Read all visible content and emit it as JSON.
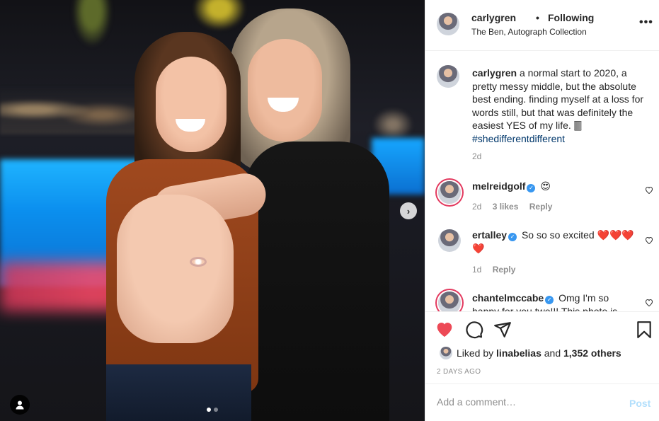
{
  "header": {
    "username": "carlygren",
    "separator": "•",
    "follow_state": "Following",
    "location": "The Ben, Autograph Collection",
    "more_label": "•••"
  },
  "caption": {
    "username": "carlygren",
    "text": "a normal start to 2020, a pretty messy middle, but the absolute best ending. finding myself at a loss for words still, but that was definitely the easiest YES of my life. 🀫",
    "hashtag": "#shedifferentdifferent",
    "age": "2d"
  },
  "comments": [
    {
      "username": "melreidgolf",
      "text": "😍",
      "age": "2d",
      "likes": "3 likes",
      "reply": "Reply"
    },
    {
      "username": "ertalley",
      "text": "So so so excited ❤️❤️❤️❤️",
      "age": "1d",
      "reply": "Reply"
    },
    {
      "username": "chantelmccabe",
      "text": "Omg I'm so happy for you two!!! This photo is"
    }
  ],
  "actions": {
    "liked_by_prefix": "Liked by",
    "liked_by_user": "linabelias",
    "liked_by_conj": "and",
    "liked_by_count": "1,352 others",
    "date": "2 DAYS AGO"
  },
  "comment_box": {
    "placeholder": "Add a comment…",
    "post_label": "Post"
  },
  "carousel": {
    "next_label": "›",
    "slides": 2,
    "active_slide": 1
  },
  "colors": {
    "like_red": "#ed4956",
    "link_blue": "#00376b",
    "verified_blue": "#3897f0",
    "post_disabled": "#b2dffc"
  }
}
